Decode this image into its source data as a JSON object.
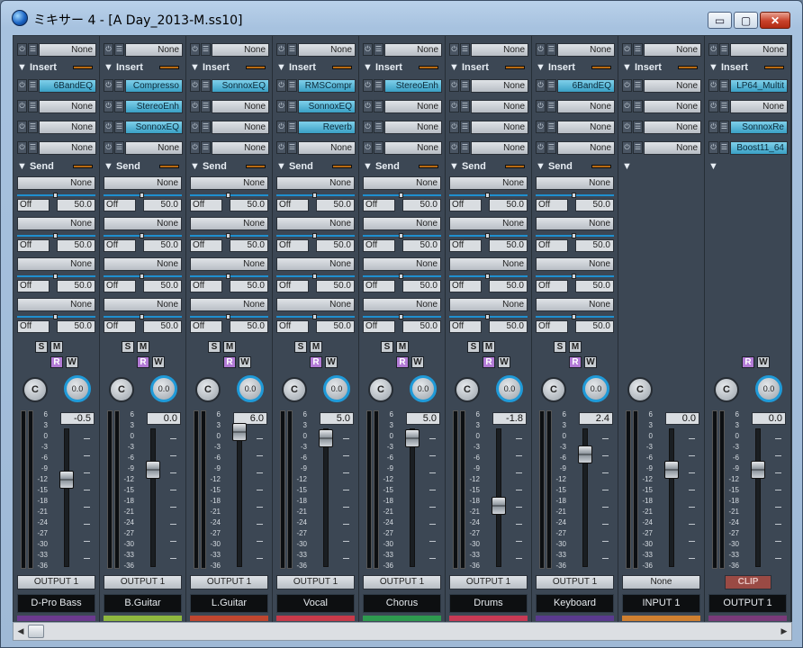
{
  "window": {
    "title": "ミキサー 4 - [A Day_2013-M.ss10]",
    "minimize": "▭",
    "maximize": "▢",
    "close": "✕"
  },
  "labels": {
    "insert": "▼ Insert",
    "send": "▼ Send",
    "collapsed": "▼",
    "none": "None",
    "off": "Off",
    "send_value": "50.0",
    "solo": "S",
    "mute": "M",
    "record": "R",
    "write": "W",
    "center": "C",
    "pan_value": "0.0",
    "clip": "CLIP"
  },
  "scale_marks": [
    "6",
    "3",
    "0",
    "-3",
    "-6",
    "-9",
    "-12",
    "-15",
    "-18",
    "-21",
    "-24",
    "-27",
    "-30",
    "-33",
    "-36"
  ],
  "channels": [
    {
      "name": "D-Pro Bass",
      "input": "None",
      "inserts": [
        "6BandEQ",
        "None",
        "None",
        "None"
      ],
      "volume": "-0.5",
      "volume_db": -0.5,
      "output": "OUTPUT 1",
      "color": "#6c3a8f",
      "sends": true,
      "sm": true,
      "rw": true
    },
    {
      "name": "B.Guitar",
      "input": "None",
      "inserts": [
        "Compresso",
        "StereoEnh",
        "SonnoxEQ",
        "None"
      ],
      "volume": "0.0",
      "volume_db": 0.0,
      "output": "OUTPUT 1",
      "color": "#8fb83f",
      "sends": true,
      "sm": true,
      "rw": true
    },
    {
      "name": "L.Guitar",
      "input": "None",
      "inserts": [
        "SonnoxEQ",
        "None",
        "None",
        "None"
      ],
      "volume": "6.0",
      "volume_db": 6.0,
      "output": "OUTPUT 1",
      "color": "#c0462f",
      "sends": true,
      "sm": true,
      "rw": true
    },
    {
      "name": "Vocal",
      "input": "None",
      "inserts": [
        "RMSCompr",
        "SonnoxEQ",
        "Reverb",
        "None"
      ],
      "volume": "5.0",
      "volume_db": 5.0,
      "output": "OUTPUT 1",
      "color": "#c83a4a",
      "sends": true,
      "sm": true,
      "rw": true
    },
    {
      "name": "Chorus",
      "input": "None",
      "inserts": [
        "StereoEnh",
        "None",
        "None",
        "None"
      ],
      "volume": "5.0",
      "volume_db": 5.0,
      "output": "OUTPUT 1",
      "color": "#2e9a4f",
      "sends": true,
      "sm": true,
      "rw": true
    },
    {
      "name": "Drums",
      "input": "None",
      "inserts": [
        "None",
        "None",
        "None",
        "None"
      ],
      "volume": "-1.8",
      "volume_db": -1.8,
      "output": "OUTPUT 1",
      "color": "#c83a55",
      "sends": true,
      "sm": true,
      "rw": true
    },
    {
      "name": "Keyboard",
      "input": "None",
      "inserts": [
        "6BandEQ",
        "None",
        "None",
        "None"
      ],
      "volume": "2.4",
      "volume_db": 2.4,
      "output": "OUTPUT 1",
      "color": "#5a3a8f",
      "sends": true,
      "sm": true,
      "rw": true
    },
    {
      "name": "INPUT 1",
      "input": "None",
      "inserts": [
        "None",
        "None",
        "None",
        "None"
      ],
      "volume": "0.0",
      "volume_db": 0.0,
      "output": "None",
      "color": "#d08030",
      "sends": false,
      "sm": false,
      "rw": false
    },
    {
      "name": "OUTPUT 1",
      "input": "None",
      "inserts": [
        "LP64_Multit",
        "None",
        "SonnoxRe",
        "Boost11_64"
      ],
      "volume": "0.0",
      "volume_db": 0.0,
      "output": "CLIP",
      "color": "#7a3a7a",
      "sends": false,
      "sm": false,
      "rw": true
    }
  ]
}
